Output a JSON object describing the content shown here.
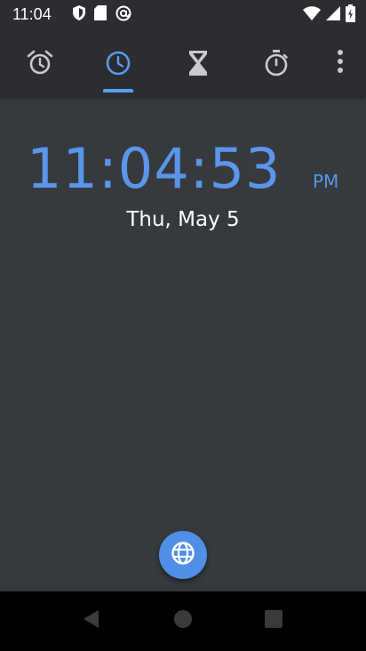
{
  "status_bar": {
    "time": "11:04",
    "icons": [
      "shield-icon",
      "sd-card-icon",
      "at-sign-icon",
      "wifi-icon",
      "cell-signal-icon",
      "battery-charging-icon"
    ]
  },
  "tabs": [
    {
      "id": "alarm",
      "icon": "alarm-clock-icon",
      "selected": false
    },
    {
      "id": "clock",
      "icon": "clock-icon",
      "selected": true
    },
    {
      "id": "timer",
      "icon": "hourglass-icon",
      "selected": false
    },
    {
      "id": "stopwatch",
      "icon": "stopwatch-icon",
      "selected": false
    }
  ],
  "overflow_menu": {
    "icon": "more-vert-icon"
  },
  "clock": {
    "time": "11:04:53",
    "ampm": "PM",
    "date": "Thu, May 5"
  },
  "fab": {
    "icon": "globe-icon"
  },
  "nav_bar": {
    "back": "back-icon",
    "home": "home-icon",
    "recents": "recents-icon"
  },
  "colors": {
    "accent": "#5a96ea",
    "fab": "#4f8fe6",
    "background": "#36393d",
    "toolbar": "#2b2d31"
  }
}
